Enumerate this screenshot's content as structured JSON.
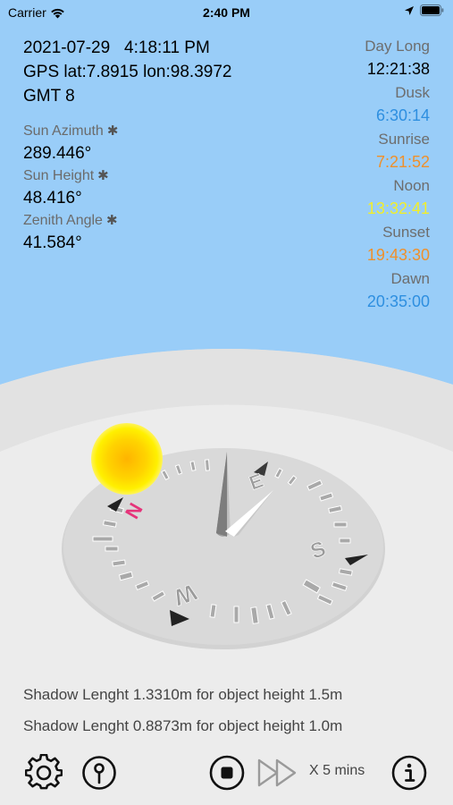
{
  "status_bar": {
    "carrier": "Carrier",
    "time": "2:40 PM"
  },
  "info": {
    "datetime": "2021-07-29   4:18:11 PM",
    "gps": "GPS lat:7.8915 lon:98.3972",
    "timezone": "GMT 8",
    "sun_azimuth_label": "Sun Azimuth",
    "sun_azimuth_value": "289.446°",
    "sun_height_label": "Sun Height",
    "sun_height_value": "48.416°",
    "zenith_angle_label": "Zenith Angle",
    "zenith_angle_value": "41.584°",
    "asterisk": "✱"
  },
  "times": {
    "day_long_label": "Day Long",
    "day_long_value": "12:21:38",
    "dusk_label": "Dusk",
    "dusk_value": "6:30:14",
    "sunrise_label": "Sunrise",
    "sunrise_value": "7:21:52",
    "noon_label": "Noon",
    "noon_value": "13:32:41",
    "sunset_label": "Sunset",
    "sunset_value": "19:43:30",
    "dawn_label": "Dawn",
    "dawn_value": "20:35:00"
  },
  "colors": {
    "sky": "#99cdf8",
    "dusk_dawn": "#2e8fe0",
    "sunrise_sunset": "#f0902a",
    "noon": "#f2ee2a",
    "north_marker": "#e5347a"
  },
  "compass": {
    "north": "N",
    "east": "E",
    "south": "S",
    "west": "W"
  },
  "shadow": {
    "line1": "Shadow Lenght 1.3310m for object height 1.5m",
    "line2": "Shadow Lenght 0.8873m for object height 1.0m"
  },
  "toolbar": {
    "speed_label": "X 5 mins",
    "icons": [
      "gear-icon",
      "pin-icon",
      "stop-icon",
      "fast-forward-icon",
      "info-icon"
    ]
  }
}
